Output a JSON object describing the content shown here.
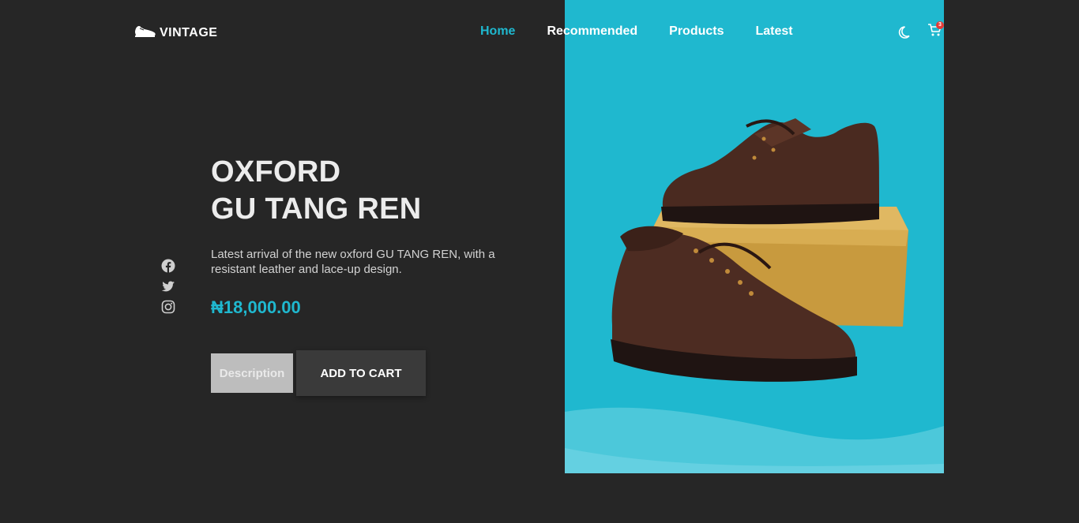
{
  "brand": {
    "name": "VINTAGE",
    "icon": "shoe-icon"
  },
  "nav": [
    {
      "label": "Home",
      "active": true
    },
    {
      "label": "Recommended",
      "active": false
    },
    {
      "label": "Products",
      "active": false
    },
    {
      "label": "Latest",
      "active": false
    }
  ],
  "header_actions": {
    "theme_icon": "moon-icon",
    "cart_icon": "cart-icon",
    "cart_count": "3"
  },
  "socials": [
    "facebook-icon",
    "twitter-icon",
    "instagram-icon"
  ],
  "hero": {
    "title_line1": "OXFORD",
    "title_line2": "GU TANG REN",
    "description": "Latest arrival of the new oxford GU TANG REN, with a resistant leather and lace-up design.",
    "price": "₦18,000.00",
    "description_button": "Description",
    "cart_button": "ADD TO CART"
  },
  "colors": {
    "accent": "#1fb8cf",
    "background": "#262626",
    "badge": "#e53935"
  }
}
